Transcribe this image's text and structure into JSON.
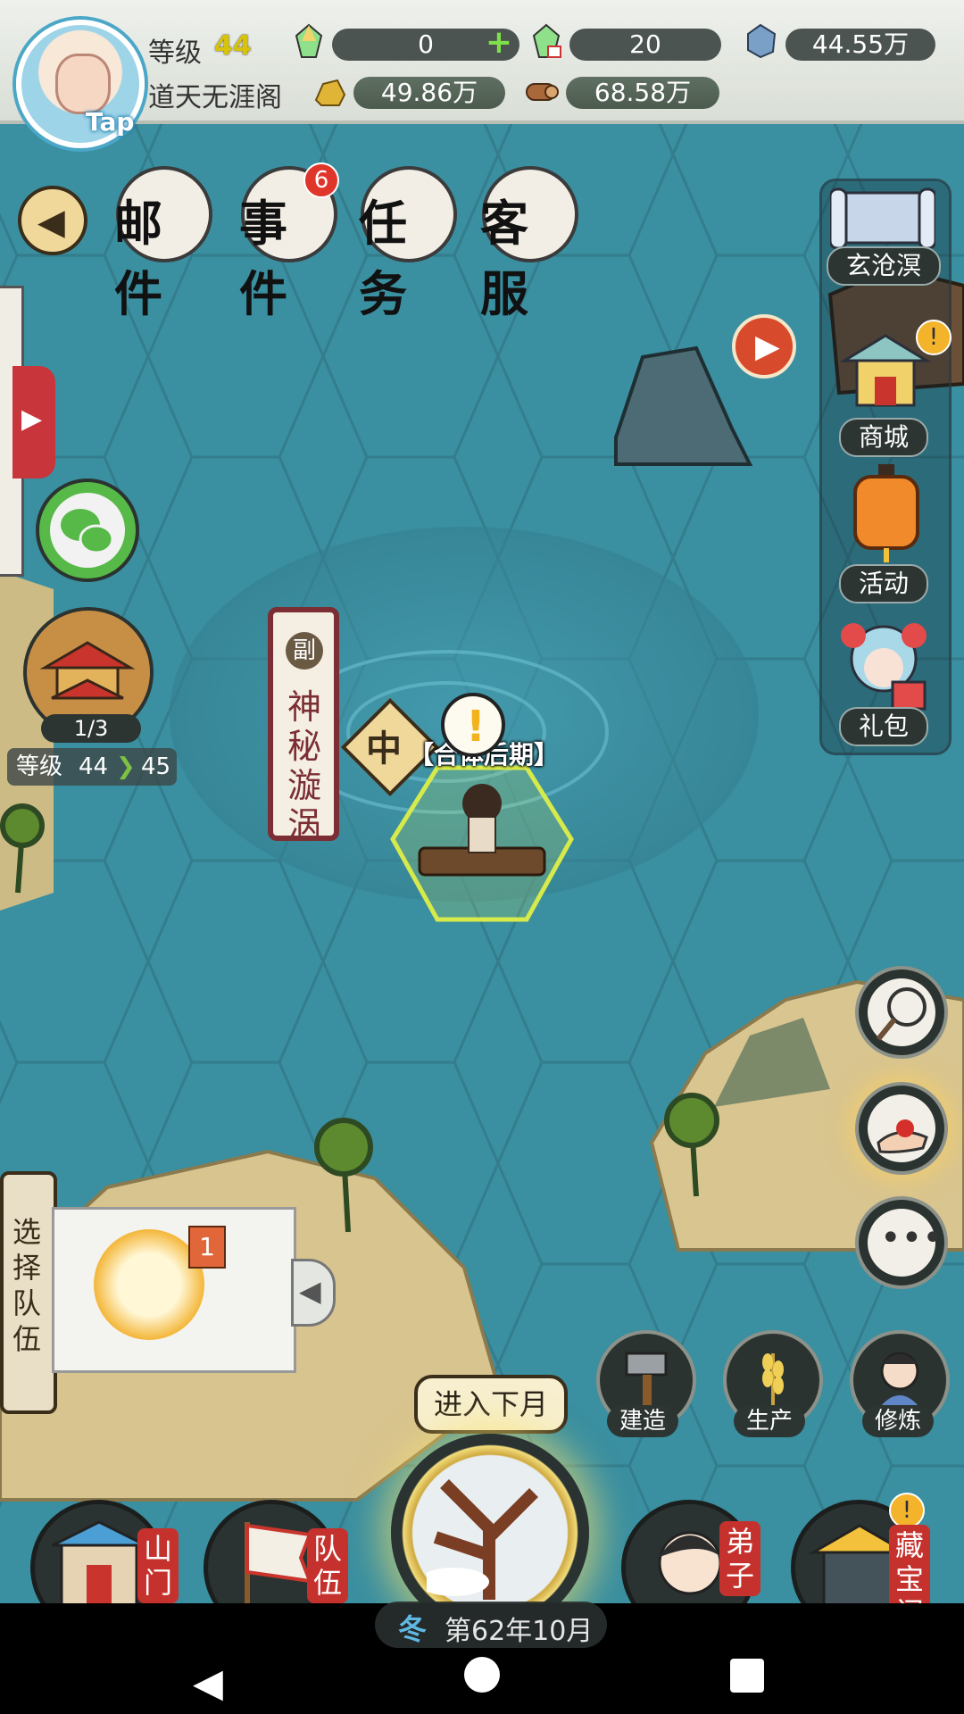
{
  "player": {
    "avatar_tag": "Tap",
    "level_label": "等级",
    "level_value": "44",
    "sect_name": "道天无涯阁"
  },
  "resources": [
    {
      "name": "rainbow-crystal",
      "value": "0",
      "has_plus": true
    },
    {
      "name": "rainbow-ticket",
      "value": "20"
    },
    {
      "name": "spirit-stone",
      "value": "44.55万"
    },
    {
      "name": "gold-ore",
      "value": "49.86万"
    },
    {
      "name": "wood",
      "value": "68.58万"
    }
  ],
  "top_menu": {
    "mail": "邮件",
    "events": "事件",
    "events_badge": "6",
    "tasks": "任务",
    "service": "客服"
  },
  "right_menu": {
    "region": "玄沧溟",
    "shop": "商城",
    "activity": "活动",
    "gift": "礼包"
  },
  "left_panel": {
    "building_progress": "1/3",
    "level_label": "等级",
    "level_from": "44",
    "level_to": "45"
  },
  "map": {
    "banner_tag": "副",
    "banner_title": "神秘漩涡",
    "tile_tag": "中",
    "tile_label": "【合体后期】"
  },
  "team": {
    "select_label": "选择队伍",
    "slot_number": "1"
  },
  "actions": {
    "build": "建造",
    "produce": "生产",
    "cultivate": "修炼"
  },
  "bottom_nav": {
    "gate": "山门",
    "team": "队伍",
    "next_month_bubble": "进入下月",
    "disciples": "弟子",
    "treasury": "藏宝阁",
    "season": "冬",
    "date": "第62年10月"
  },
  "colors": {
    "water": "#3a8fa0",
    "accent_red": "#c5322d",
    "level_yellow": "#d8c30a",
    "button_dark": "#2c3532"
  }
}
